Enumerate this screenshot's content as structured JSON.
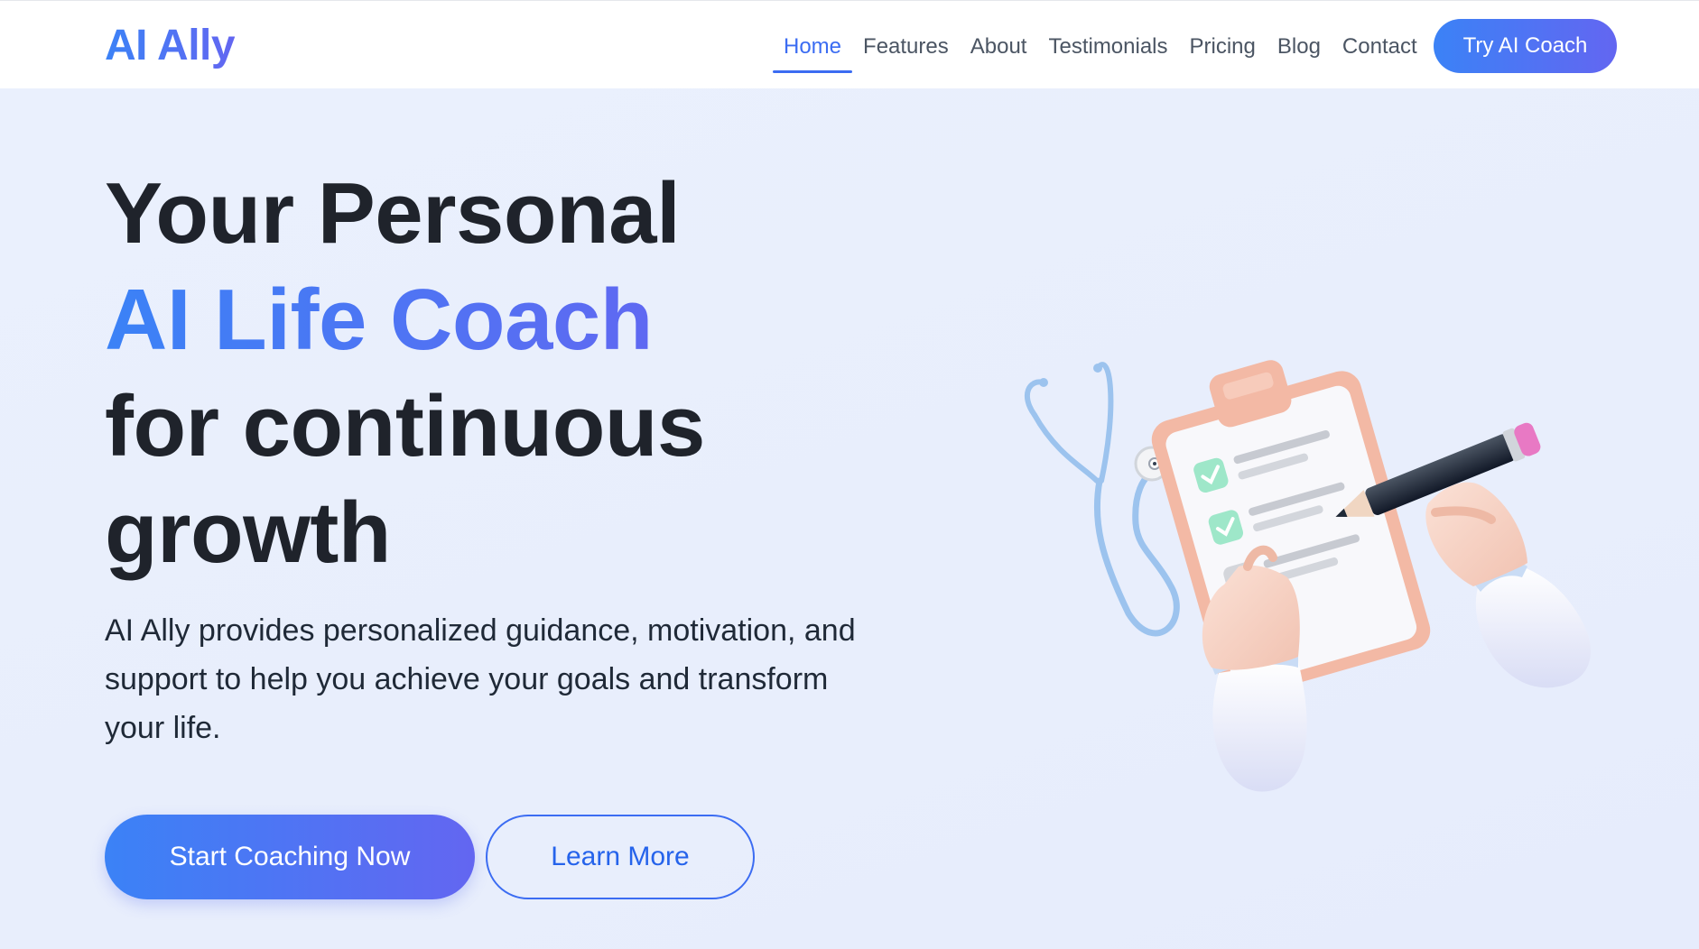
{
  "nav": {
    "brand": "AI Ally",
    "links": [
      {
        "label": "Home",
        "active": true
      },
      {
        "label": "Features",
        "active": false
      },
      {
        "label": "About",
        "active": false
      },
      {
        "label": "Testimonials",
        "active": false
      },
      {
        "label": "Pricing",
        "active": false
      },
      {
        "label": "Blog",
        "active": false
      },
      {
        "label": "Contact",
        "active": false
      }
    ],
    "cta_label": "Try AI Coach"
  },
  "hero": {
    "title_line1": "Your Personal",
    "title_line2": "AI Life Coach",
    "title_line3": "for continuous",
    "title_line4": "growth",
    "description": "AI Ally provides personalized guidance, motivation, and support to help you achieve your goals and transform your life.",
    "primary_button": "Start Coaching Now",
    "secondary_button": "Learn More"
  },
  "colors": {
    "accent_start": "#3b82f6",
    "accent_end": "#6366f1",
    "heading": "#1f232b",
    "background": "#e9effd"
  },
  "icons": {
    "illustration": "doctor-hands-clipboard-stethoscope-illustration"
  }
}
